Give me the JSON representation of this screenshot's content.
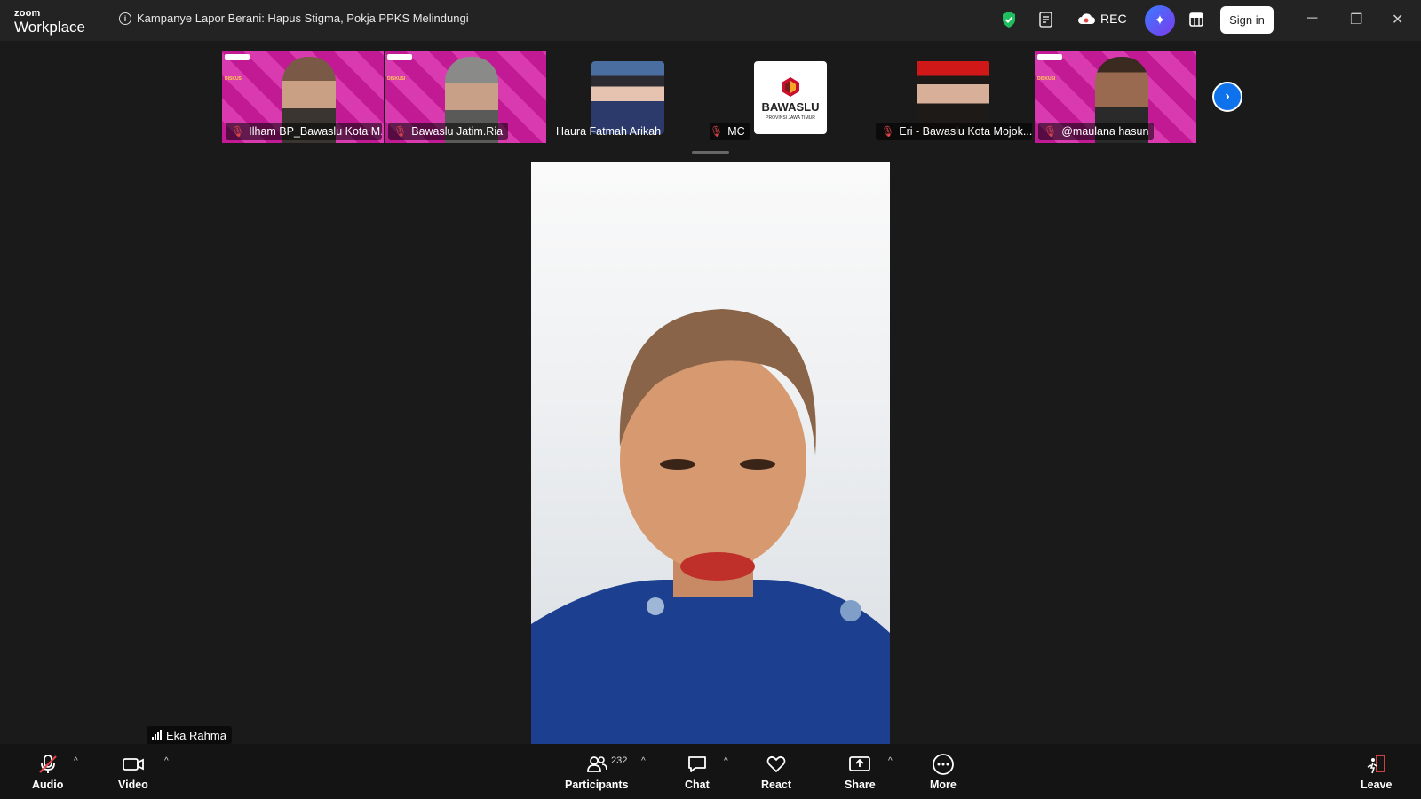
{
  "app": {
    "brand_small": "zoom",
    "brand_name": "Workplace"
  },
  "meeting": {
    "title": "Kampanye Lapor Berani: Hapus Stigma, Pokja PPKS Melindungi"
  },
  "titlebar": {
    "rec_label": "REC",
    "signin_label": "Sign in"
  },
  "participants_strip": [
    {
      "name": "Ilham BP_Bawaslu Kota M...",
      "muted": true,
      "style": "slide"
    },
    {
      "name": "Bawaslu Jatim.Ria",
      "muted": true,
      "style": "slide"
    },
    {
      "name": "Haura Fatmah Arikah",
      "muted": false,
      "style": "photo"
    },
    {
      "name": "MC",
      "muted": true,
      "style": "logo",
      "logo_text": "BAWASLU",
      "logo_subtext": "PROVINSI JAWA TIMUR"
    },
    {
      "name": "Eri - Bawaslu Kota Mojok...",
      "muted": true,
      "style": "photo-red"
    },
    {
      "name": "@maulana hasun",
      "muted": true,
      "style": "slide"
    }
  ],
  "active_speaker": {
    "name": "Eka Rahma"
  },
  "toolbar": {
    "audio_label": "Audio",
    "video_label": "Video",
    "participants_label": "Participants",
    "participants_count": "232",
    "chat_label": "Chat",
    "react_label": "React",
    "share_label": "Share",
    "more_label": "More",
    "leave_label": "Leave"
  },
  "colors": {
    "accent": "#0e72ed",
    "muted_red": "#e04848",
    "slide_pink": "#c21a94",
    "secure_green": "#1fbf5f"
  }
}
